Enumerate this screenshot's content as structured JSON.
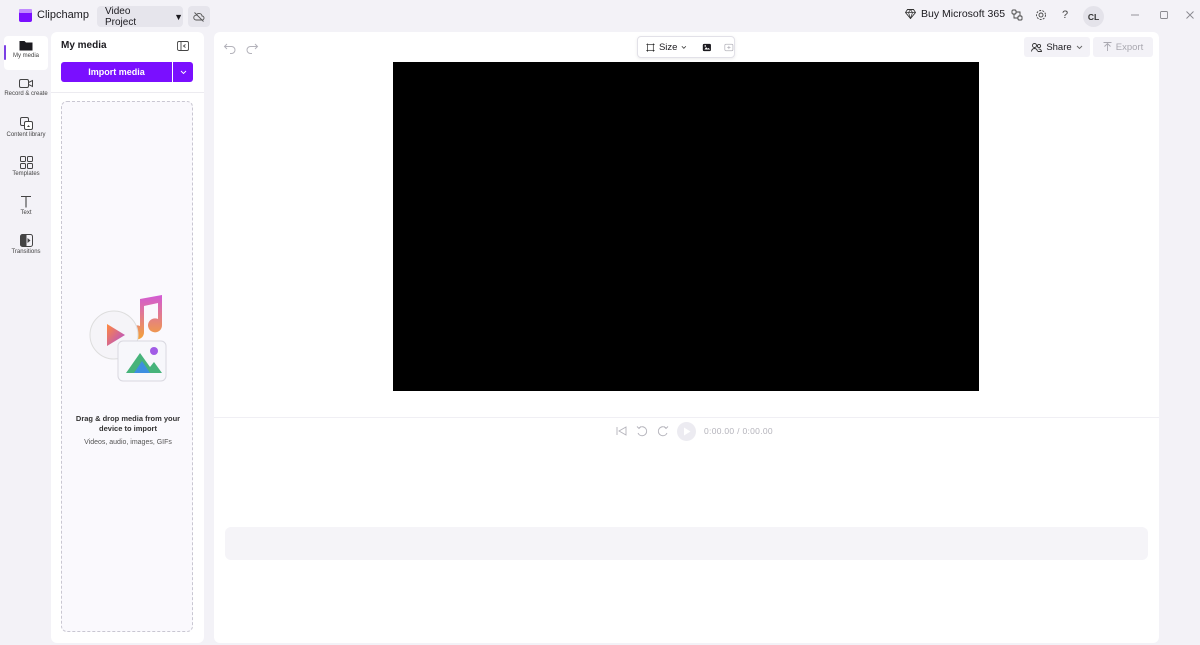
{
  "app": {
    "name": "Clipchamp",
    "brand_color": "#7a0fff"
  },
  "titlebar": {
    "project_label": "Video Project",
    "buy_label": "Buy Microsoft 365",
    "avatar_initials": "CL"
  },
  "rail": {
    "items": [
      {
        "label": "My media",
        "icon": "folder-icon",
        "active": true
      },
      {
        "label": "Record & create",
        "icon": "camera-icon"
      },
      {
        "label": "Content library",
        "icon": "library-icon"
      },
      {
        "label": "Templates",
        "icon": "grid-icon"
      },
      {
        "label": "Text",
        "icon": "text-icon"
      },
      {
        "label": "Transitions",
        "icon": "transition-icon"
      }
    ]
  },
  "media_panel": {
    "title": "My media",
    "import_label": "Import media",
    "drop_title": "Drag & drop media from your device to import",
    "drop_sub": "Videos, audio, images, GIFs"
  },
  "editor": {
    "size_label": "Size",
    "share_label": "Share",
    "export_label": "Export",
    "time_display": "0:00.00 / 0:00.00",
    "preview_color": "#000000"
  }
}
